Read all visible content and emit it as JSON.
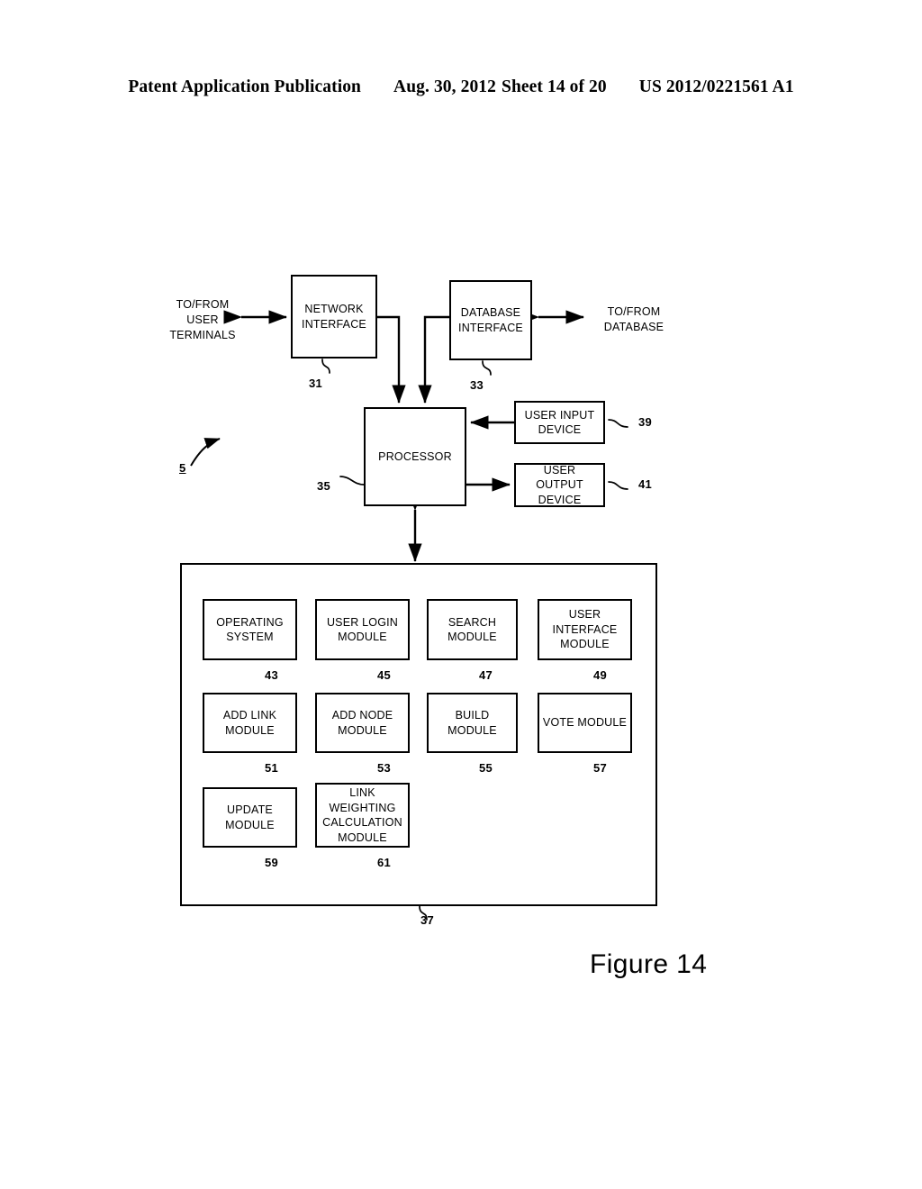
{
  "header": {
    "publication": "Patent Application Publication",
    "date": "Aug. 30, 2012",
    "sheet": "Sheet 14 of 20",
    "number": "US 2012/0221561 A1"
  },
  "figure": {
    "caption": "Figure 14",
    "system_ref": "5"
  },
  "io_labels": {
    "left": "TO/FROM\nUSER\nTERMINALS",
    "right": "TO/FROM\nDATABASE"
  },
  "blocks": {
    "network_interface": {
      "label": "NETWORK\nINTERFACE",
      "ref": "31"
    },
    "database_interface": {
      "label": "DATABASE\nINTERFACE",
      "ref": "33"
    },
    "processor": {
      "label": "PROCESSOR",
      "ref": "35"
    },
    "user_input_device": {
      "label": "USER INPUT\nDEVICE",
      "ref": "39"
    },
    "user_output_device": {
      "label": "USER OUTPUT\nDEVICE",
      "ref": "41"
    },
    "memory": {
      "ref": "37"
    }
  },
  "modules": [
    {
      "label": "OPERATING\nSYSTEM",
      "ref": "43"
    },
    {
      "label": "USER LOGIN\nMODULE",
      "ref": "45"
    },
    {
      "label": "SEARCH\nMODULE",
      "ref": "47"
    },
    {
      "label": "USER INTERFACE\nMODULE",
      "ref": "49"
    },
    {
      "label": "ADD LINK\nMODULE",
      "ref": "51"
    },
    {
      "label": "ADD NODE\nMODULE",
      "ref": "53"
    },
    {
      "label": "BUILD MODULE",
      "ref": "55"
    },
    {
      "label": "VOTE MODULE",
      "ref": "57"
    },
    {
      "label": "UPDATE\nMODULE",
      "ref": "59"
    },
    {
      "label": "LINK\nWEIGHTING\nCALCULATION\nMODULE",
      "ref": "61"
    }
  ],
  "colors": {
    "ink": "#000000",
    "paper": "#ffffff"
  }
}
